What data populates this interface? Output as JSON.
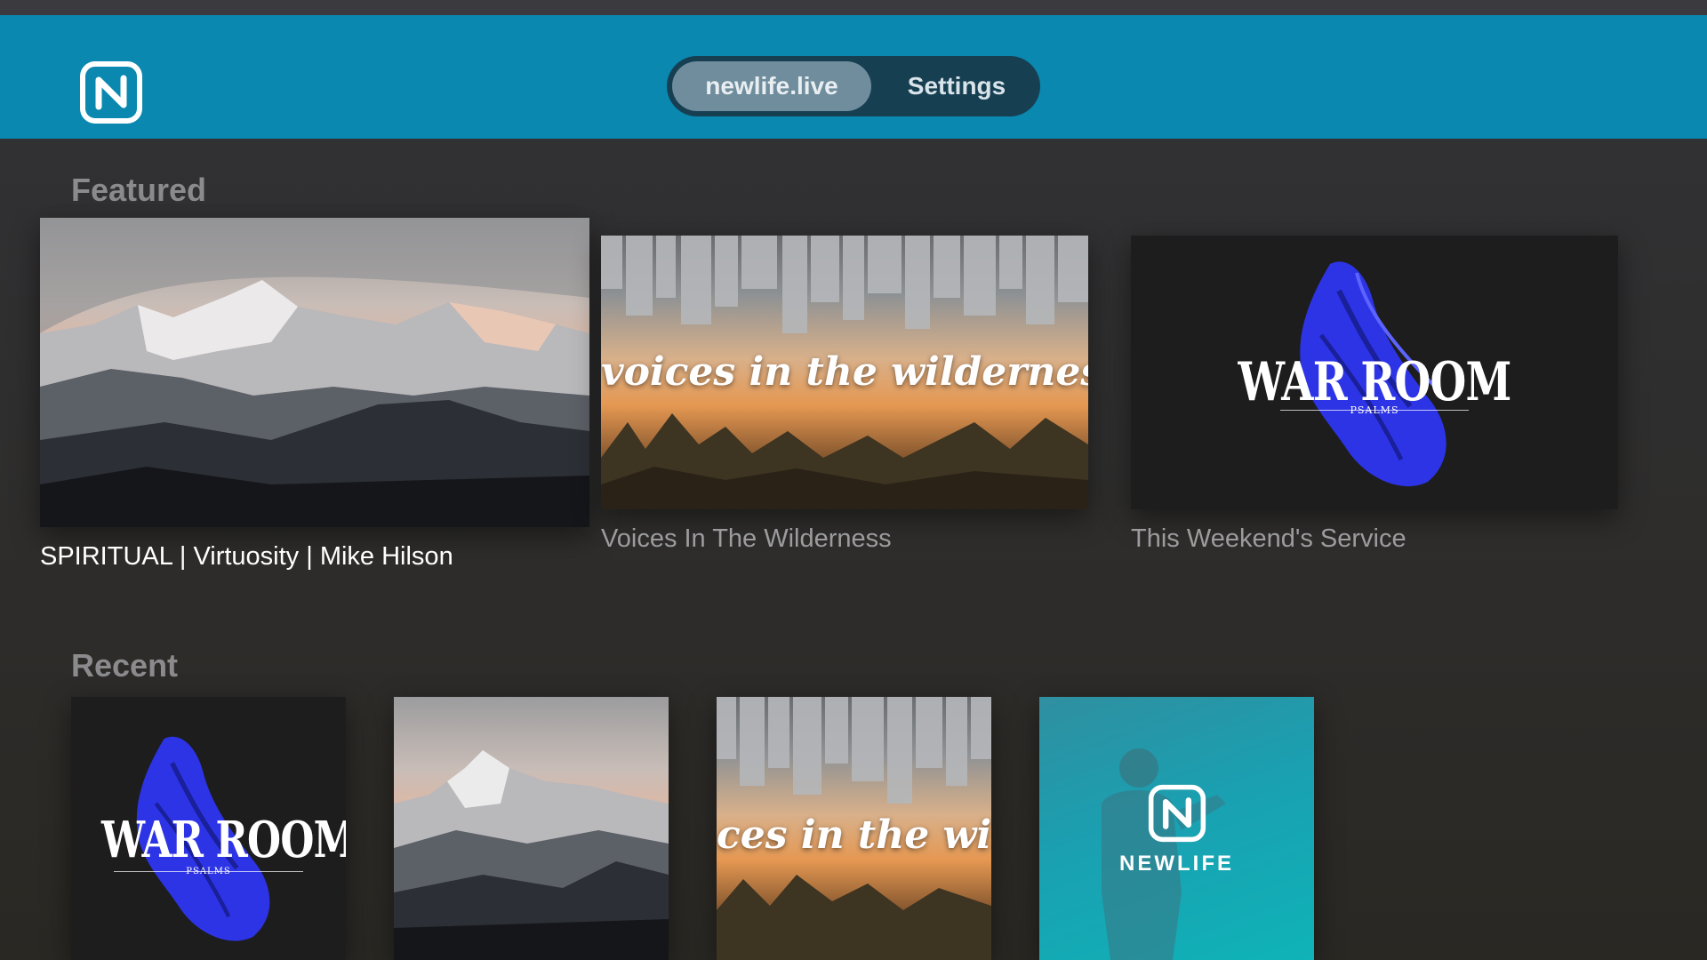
{
  "header": {
    "tabs": [
      {
        "label": "newlife.live",
        "active": true
      },
      {
        "label": "Settings",
        "active": false
      }
    ],
    "logo_icon": "newlife-n-logo-icon",
    "accent_color": "#0a88b0"
  },
  "featured": {
    "title": "Featured",
    "items": [
      {
        "caption": "SPIRITUAL | Virtuosity | Mike Hilson",
        "artwork": "mountain",
        "focused": true
      },
      {
        "caption": "Voices In The Wilderness",
        "artwork": "wilderness",
        "art_text": "voices in the wilderness"
      },
      {
        "caption": "This Weekend's Service",
        "artwork": "war-room",
        "art_title": "WAR ROOM",
        "art_subtitle": "PSALMS"
      }
    ]
  },
  "recent": {
    "title": "Recent",
    "items": [
      {
        "artwork": "war-room",
        "art_title": "WAR ROOM",
        "art_subtitle": "PSALMS"
      },
      {
        "artwork": "mountain"
      },
      {
        "artwork": "wilderness",
        "art_text": "ces in the wildern"
      },
      {
        "artwork": "newlife",
        "art_text": "NEWLIFE"
      }
    ]
  }
}
